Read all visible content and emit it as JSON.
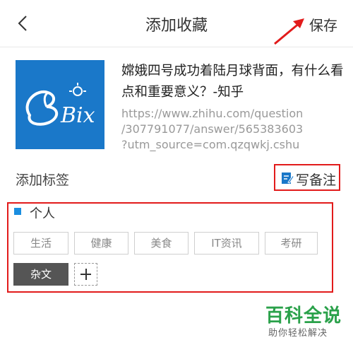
{
  "header": {
    "title": "添加收藏",
    "save_label": "保存"
  },
  "link": {
    "title": "嫦娥四号成功着陆月球背面，有什么看点和重要意义？-知乎",
    "url": "https://www.zhihu.com/question\n/307791077/answer/565383603\n?utm_source=com.qzqwkj.cshu",
    "thumbnail_text": "Bix"
  },
  "tags_section": {
    "label": "添加标签",
    "note_label": "写备注"
  },
  "group": {
    "name": "个人",
    "tags": [
      {
        "label": "生活",
        "selected": false
      },
      {
        "label": "健康",
        "selected": false
      },
      {
        "label": "美食",
        "selected": false
      },
      {
        "label": "IT资讯",
        "selected": false
      },
      {
        "label": "考研",
        "selected": false
      },
      {
        "label": "杂文",
        "selected": true
      }
    ]
  },
  "watermark": {
    "main": "百科全说",
    "sub": "助你轻松解决"
  },
  "colors": {
    "accent_blue": "#1a78c9",
    "highlight_red": "#e21b1b",
    "selected_tag": "#555555",
    "watermark_green": "#2aa14a"
  }
}
